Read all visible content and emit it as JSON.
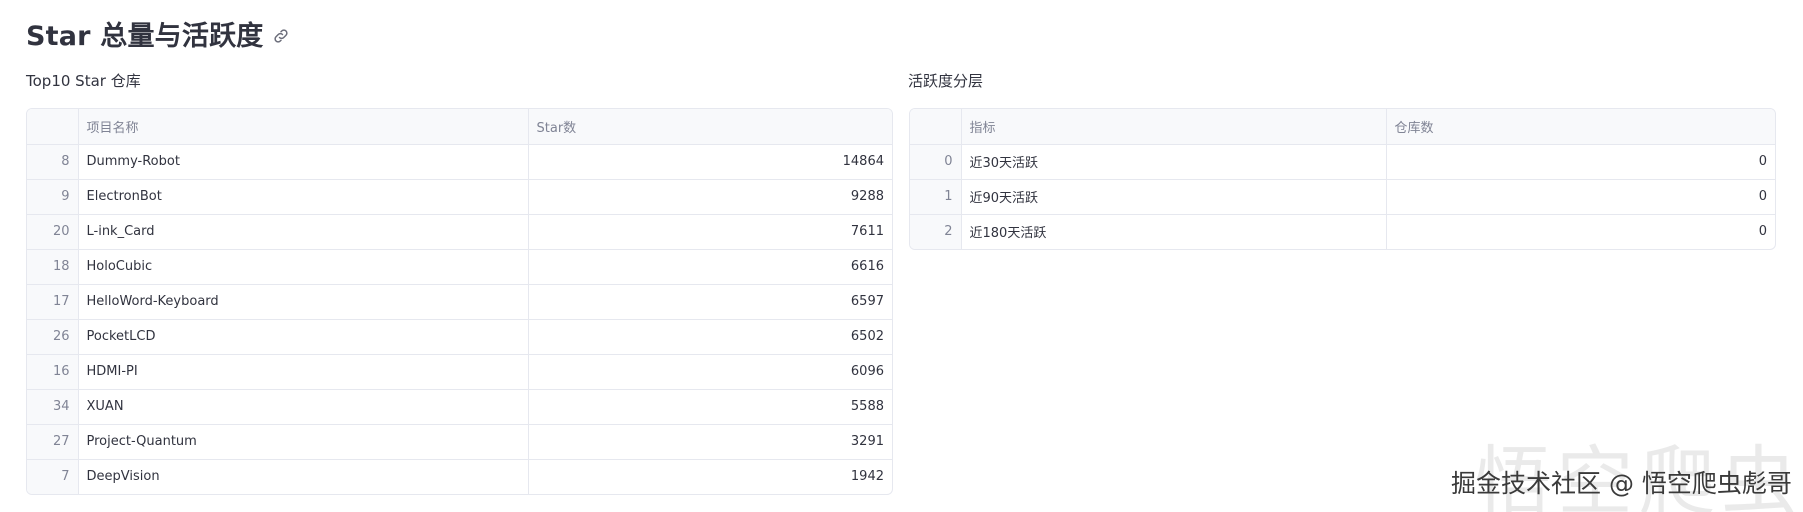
{
  "page": {
    "title": "Star 总量与活跃度"
  },
  "left": {
    "title": "Top10 Star 仓库",
    "columns": [
      "项目名称",
      "Star数"
    ],
    "rows": [
      {
        "index": "8",
        "name": "Dummy-Robot",
        "stars": "14864"
      },
      {
        "index": "9",
        "name": "ElectronBot",
        "stars": "9288"
      },
      {
        "index": "20",
        "name": "L-ink_Card",
        "stars": "7611"
      },
      {
        "index": "18",
        "name": "HoloCubic",
        "stars": "6616"
      },
      {
        "index": "17",
        "name": "HelloWord-Keyboard",
        "stars": "6597"
      },
      {
        "index": "26",
        "name": "PocketLCD",
        "stars": "6502"
      },
      {
        "index": "16",
        "name": "HDMI-PI",
        "stars": "6096"
      },
      {
        "index": "34",
        "name": "XUAN",
        "stars": "5588"
      },
      {
        "index": "27",
        "name": "Project-Quantum",
        "stars": "3291"
      },
      {
        "index": "7",
        "name": "DeepVision",
        "stars": "1942"
      }
    ]
  },
  "right": {
    "title": "活跃度分层",
    "columns": [
      "指标",
      "仓库数"
    ],
    "rows": [
      {
        "index": "0",
        "metric": "近30天活跃",
        "count": "0"
      },
      {
        "index": "1",
        "metric": "近90天活跃",
        "count": "0"
      },
      {
        "index": "2",
        "metric": "近180天活跃",
        "count": "0"
      }
    ]
  },
  "watermark": {
    "text": "掘金技术社区 @ 悟空爬虫彪哥",
    "big_text": "悟空爬虫"
  },
  "icons": {
    "heading_anchor": "link-icon"
  }
}
